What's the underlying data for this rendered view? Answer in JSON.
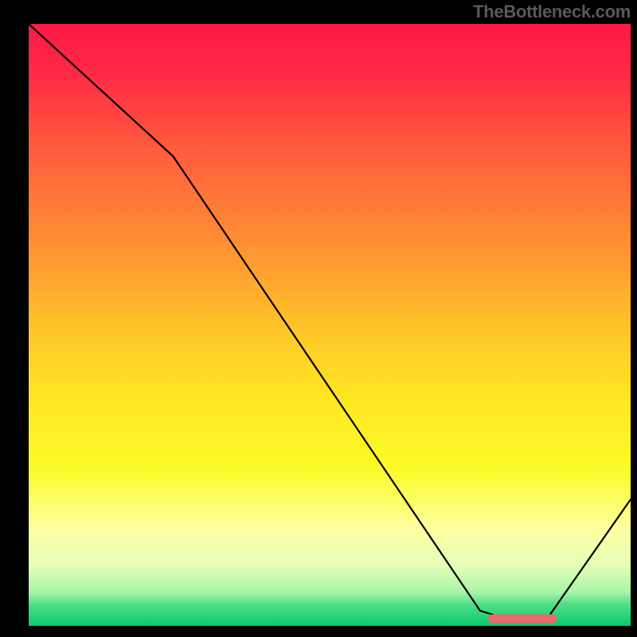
{
  "attribution": "TheBottleneck.com",
  "chart_data": {
    "type": "line",
    "title": "",
    "xlabel": "",
    "ylabel": "",
    "xlim": [
      0,
      100
    ],
    "ylim": [
      0,
      100
    ],
    "background": {
      "type": "vertical-gradient",
      "stops": [
        {
          "offset": 0.0,
          "color": "#ff1846"
        },
        {
          "offset": 0.08,
          "color": "#ff2945"
        },
        {
          "offset": 0.2,
          "color": "#ff593d"
        },
        {
          "offset": 0.35,
          "color": "#ff8a34"
        },
        {
          "offset": 0.5,
          "color": "#ffc22a"
        },
        {
          "offset": 0.62,
          "color": "#ffe622"
        },
        {
          "offset": 0.74,
          "color": "#fbfb28"
        },
        {
          "offset": 0.84,
          "color": "#fdffa2"
        },
        {
          "offset": 0.9,
          "color": "#e5ffb8"
        },
        {
          "offset": 0.945,
          "color": "#a4f4a8"
        },
        {
          "offset": 0.965,
          "color": "#4fdd87"
        },
        {
          "offset": 1.0,
          "color": "#09cb6e"
        }
      ]
    },
    "series": [
      {
        "name": "bottleneck-curve",
        "x": [
          0,
          24,
          75,
          80,
          86,
          100
        ],
        "y": [
          100,
          78,
          2.5,
          1,
          1,
          21
        ]
      }
    ],
    "optimal_region": {
      "x_start": 77,
      "x_end": 87,
      "y": 1.2,
      "color": "#e86b6c"
    }
  }
}
